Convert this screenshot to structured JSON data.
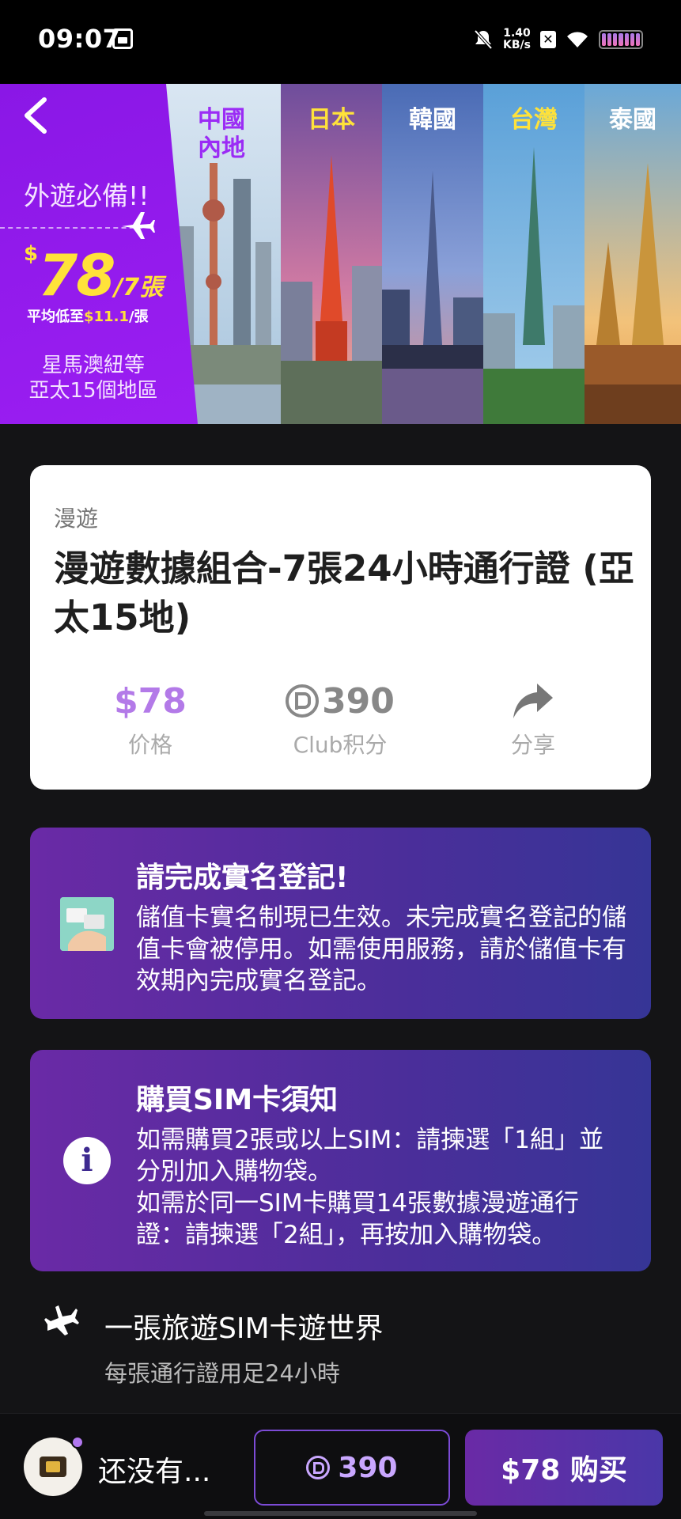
{
  "status_bar": {
    "time": "09:07",
    "net_speed_value": "1.40",
    "net_speed_unit": "KB/s"
  },
  "banner": {
    "promo_must_have": "外遊必備!!",
    "price_currency": "$",
    "price_amount": "78",
    "price_unit": "/7張",
    "avg_prefix": "平均低至",
    "avg_price": "$11.1",
    "avg_unit": "/張",
    "region_line1": "星馬澳紐等",
    "region_line2": "亞太15個地區",
    "destinations": [
      {
        "label": "中國\n內地",
        "color": "#9b2cf5"
      },
      {
        "label": "日本",
        "color": "#ffe23a"
      },
      {
        "label": "韓國",
        "color": "#ffffff"
      },
      {
        "label": "台灣",
        "color": "#ffe23a"
      },
      {
        "label": "泰國",
        "color": "#ffffff"
      }
    ]
  },
  "product": {
    "category": "漫遊",
    "title": "漫遊數據組合-7張24小時通行證 (亞太15地)",
    "price_value": "$78",
    "price_label": "价格",
    "points_value": "390",
    "points_label": "Club积分",
    "share_label": "分享"
  },
  "notice_realname": {
    "title": "請完成實名登記!",
    "body": "儲值卡實名制現已生效。未完成實名登記的儲值卡會被停用。如需使用服務，請於儲值卡有效期內完成實名登記。"
  },
  "notice_sim": {
    "title": "購買SIM卡須知",
    "body_line1": "如需購買2張或以上SIM：請揀選「1組」並分別加入購物袋。",
    "body_line2": "如需於同一SIM卡購買14張數據漫遊通行證：請揀選「2組」，再按加入購物袋。"
  },
  "feature": {
    "title": "一張旅遊SIM卡遊世界",
    "subtitle": "每張通行證用足24小時"
  },
  "bottom_bar": {
    "not_yet_label": "还没有...",
    "points_button": "390",
    "buy_button": "$78 购买"
  },
  "colors": {
    "accent_purple": "#9b1ef2",
    "price_purple": "#b37ae8",
    "promo_yellow": "#ffe23a",
    "notice_gradient_start": "#6a2aa6",
    "notice_gradient_end": "#363596"
  },
  "icons": [
    "back-chevron-icon",
    "airplane-icon",
    "club-points-icon",
    "share-arrow-icon",
    "id-card-icon",
    "info-icon",
    "sim-card-icon"
  ]
}
